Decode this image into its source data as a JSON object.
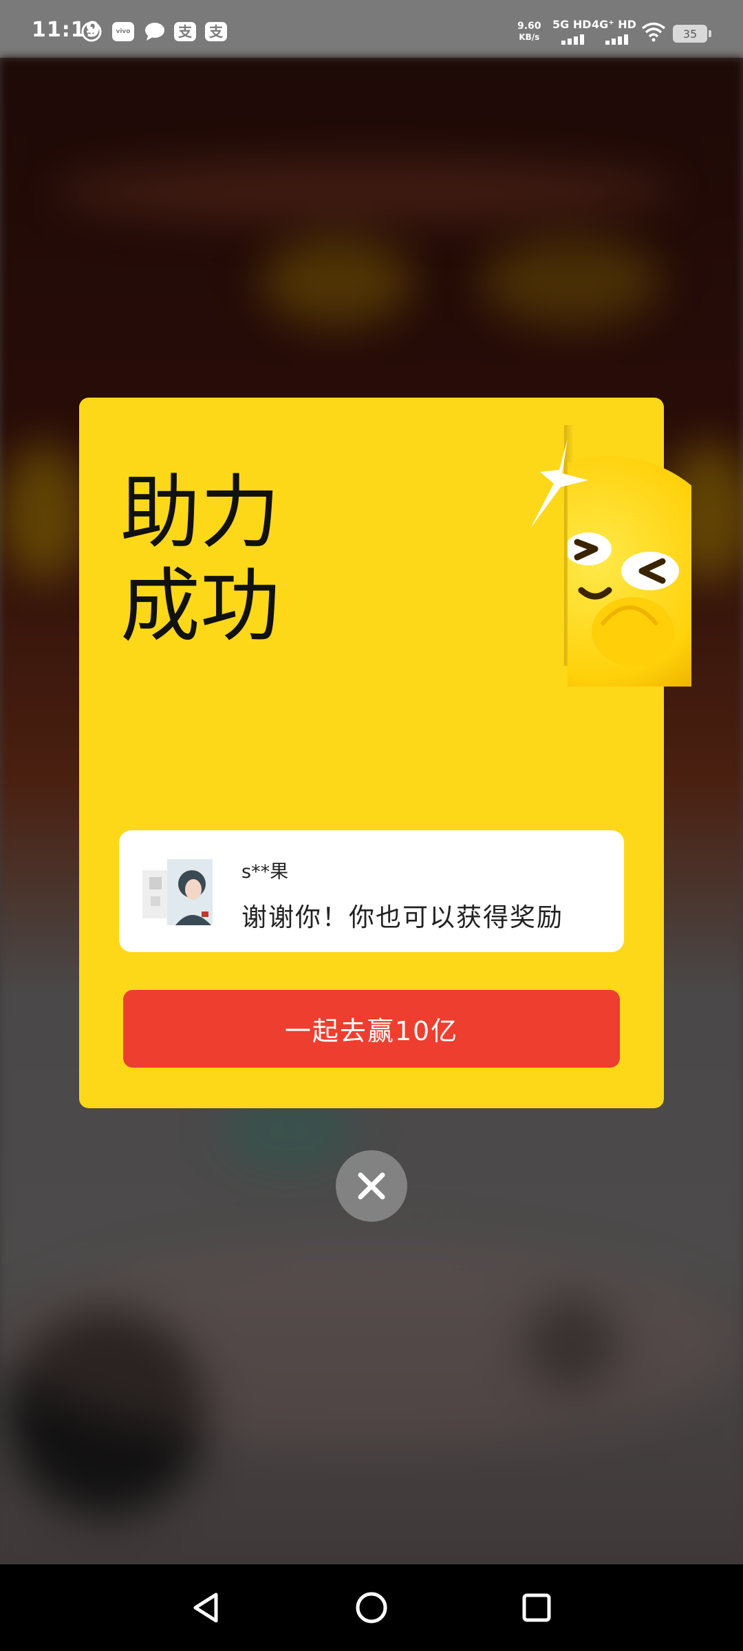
{
  "status_bar": {
    "time": "11:19",
    "app_icons": [
      "plus-circle-icon",
      "vivo-icon",
      "message-bubble-icon",
      "alipay-icon",
      "alipay-icon"
    ],
    "alipay_glyph": "支",
    "vivo_label": "vivo",
    "network_speed": "9.60",
    "network_speed_unit": "KB/s",
    "network_1": "5G HD",
    "network_2": "4G⁺ HD",
    "battery": "35"
  },
  "popup": {
    "title_line1": "助力",
    "title_line2": "成功",
    "friend": {
      "name": "s**果",
      "message": "谢谢你！你也可以获得奖励"
    },
    "cta_label": "一起去赢10亿",
    "close_icon": "close-x-icon"
  },
  "colors": {
    "card": "#fdd819",
    "cta": "#ee3e2f",
    "friend_box": "#ffffff",
    "status_bar": "#7a7a7a",
    "nav_bar": "#000000"
  },
  "nav_bar": {
    "back_icon": "back-triangle-icon",
    "home_icon": "home-circle-icon",
    "recents_icon": "recents-square-icon"
  }
}
